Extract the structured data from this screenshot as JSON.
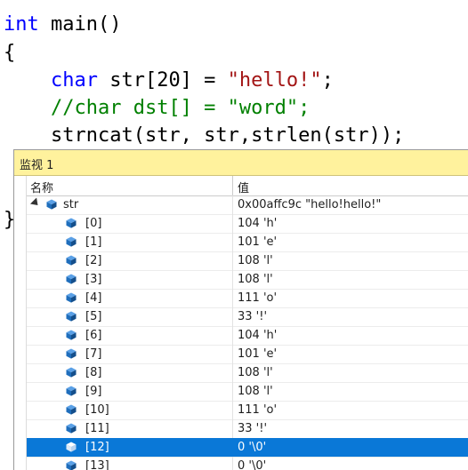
{
  "editor": {
    "line1": {
      "kw": "int",
      "rest": " main()"
    },
    "line2": "{",
    "line3": {
      "kw": "char",
      "mid": " str[20] = ",
      "str": "\"hello!\"",
      "end": ";"
    },
    "line4": "//char dst[] = \"word\";",
    "line5": "strncat(str, str,strlen(str));",
    "line6": "}"
  },
  "watch": {
    "title": "监视 1",
    "columns": {
      "name": "名称",
      "value": "值"
    },
    "root": {
      "name": "str",
      "value": "0x00affc9c \"hello!hello!\"",
      "icon": "variable-cube-icon"
    },
    "items": [
      {
        "name": "[0]",
        "value": "104 'h'"
      },
      {
        "name": "[1]",
        "value": "101 'e'"
      },
      {
        "name": "[2]",
        "value": "108 'l'"
      },
      {
        "name": "[3]",
        "value": "108 'l'"
      },
      {
        "name": "[4]",
        "value": "111 'o'"
      },
      {
        "name": "[5]",
        "value": "33 '!'"
      },
      {
        "name": "[6]",
        "value": "104 'h'"
      },
      {
        "name": "[7]",
        "value": "101 'e'"
      },
      {
        "name": "[8]",
        "value": "108 'l'"
      },
      {
        "name": "[9]",
        "value": "108 'l'"
      },
      {
        "name": "[10]",
        "value": "111 'o'"
      },
      {
        "name": "[11]",
        "value": "33 '!'"
      },
      {
        "name": "[12]",
        "value": "0 '\\0'",
        "selected": true
      },
      {
        "name": "[13]",
        "value": "0 '\\0'"
      }
    ]
  },
  "colors": {
    "keyword": "#0000ff",
    "string": "#a31515",
    "comment": "#008000",
    "watch_title_bg": "#fff29d",
    "selection": "#0a78d7"
  }
}
